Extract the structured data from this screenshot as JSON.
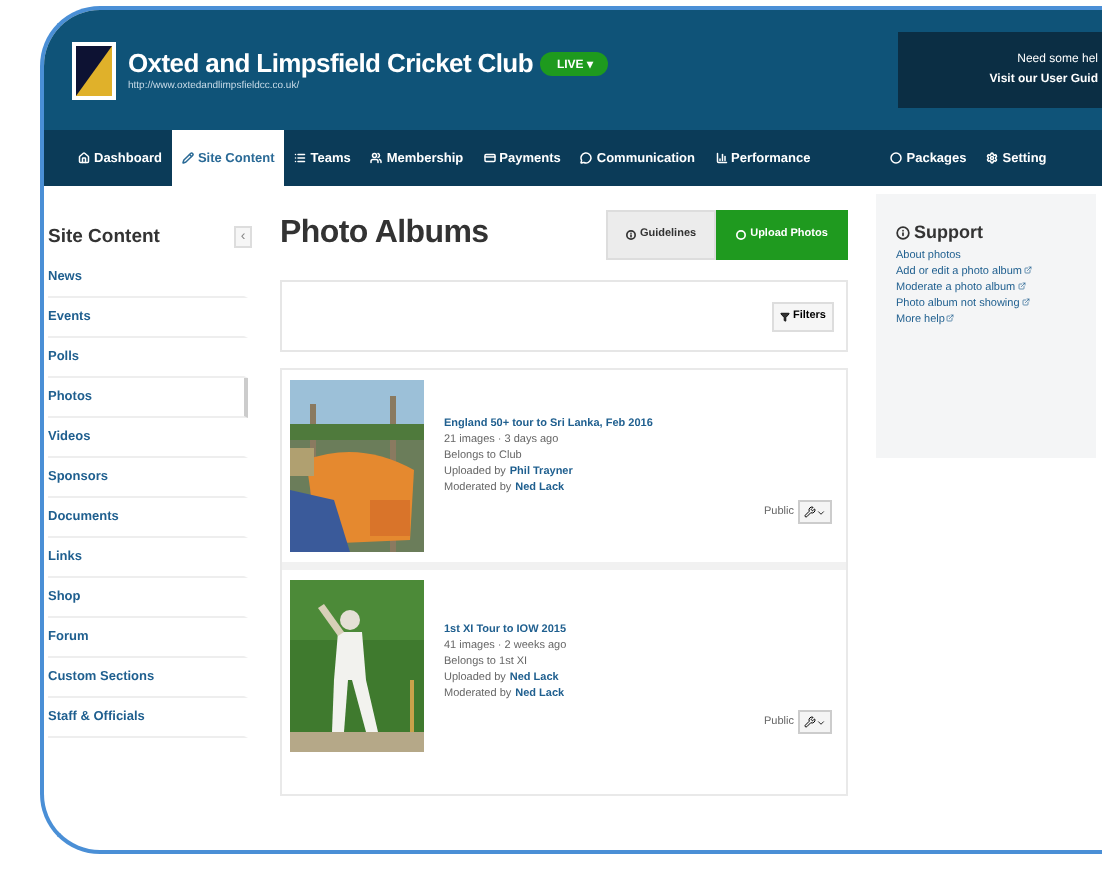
{
  "header": {
    "club_name": "Oxted and Limpsfield Cricket Club",
    "status_badge": "LIVE ▾",
    "url": "http://www.oxtedandlimpsfieldcc.co.uk/",
    "help_line_1": "Need some hel",
    "help_line_2": "Visit our User Guid"
  },
  "nav": {
    "left": [
      {
        "label": "Dashboard",
        "selected": false
      },
      {
        "label": "Site Content",
        "selected": true
      },
      {
        "label": "Teams",
        "selected": false
      },
      {
        "label": "Membership",
        "selected": false
      },
      {
        "label": "Payments",
        "selected": false
      },
      {
        "label": "Communication",
        "selected": false
      },
      {
        "label": "Performance",
        "selected": false
      }
    ],
    "right": [
      {
        "label": "Packages",
        "selected": false
      },
      {
        "label": "Setting",
        "selected": false
      }
    ]
  },
  "sidebar": {
    "title": "Site Content",
    "collapse": "‹",
    "items": [
      {
        "label": "News",
        "selected": false
      },
      {
        "label": "Events",
        "selected": false
      },
      {
        "label": "Polls",
        "selected": false
      },
      {
        "label": "Photos",
        "selected": true
      },
      {
        "label": "Videos",
        "selected": false
      },
      {
        "label": "Sponsors",
        "selected": false
      },
      {
        "label": "Documents",
        "selected": false
      },
      {
        "label": "Links",
        "selected": false
      },
      {
        "label": "Shop",
        "selected": false
      },
      {
        "label": "Forum",
        "selected": false
      },
      {
        "label": "Custom Sections",
        "selected": false
      },
      {
        "label": "Staff & Officials",
        "selected": false
      }
    ]
  },
  "main": {
    "title": "Photo Albums",
    "guidelines_button": "Guidelines",
    "upload_button": "Upload Photos",
    "filters_button": "Filters",
    "albums": [
      {
        "kind": "picture",
        "title": "England 50+ tour to Sri Lanka, Feb 2016",
        "stats": "21 images · 3 days ago",
        "belongs": "Belongs to Club",
        "uploaded_label": "Uploaded by",
        "uploaded_by": "Phil Trayner",
        "moderated_label": "Moderated by",
        "moderated_by": "Ned Lack",
        "visibility": "Public"
      },
      {
        "kind": "picture",
        "title": "1st XI Tour to IOW 2015",
        "stats": "41 images · 2 weeks ago",
        "belongs": "Belongs to 1st XI",
        "uploaded_label": "Uploaded by",
        "uploaded_by": "Ned Lack",
        "moderated_label": "Moderated by",
        "moderated_by": "Ned Lack",
        "visibility": "Public"
      }
    ]
  },
  "support": {
    "title": "Support",
    "links": [
      {
        "label": "About photos",
        "external": false
      },
      {
        "label": "Add or edit a photo album",
        "external": true
      },
      {
        "label": "Moderate a photo album",
        "external": true
      },
      {
        "label": "Photo album not showing",
        "external": true
      },
      {
        "label": "More help",
        "external": true
      }
    ]
  }
}
